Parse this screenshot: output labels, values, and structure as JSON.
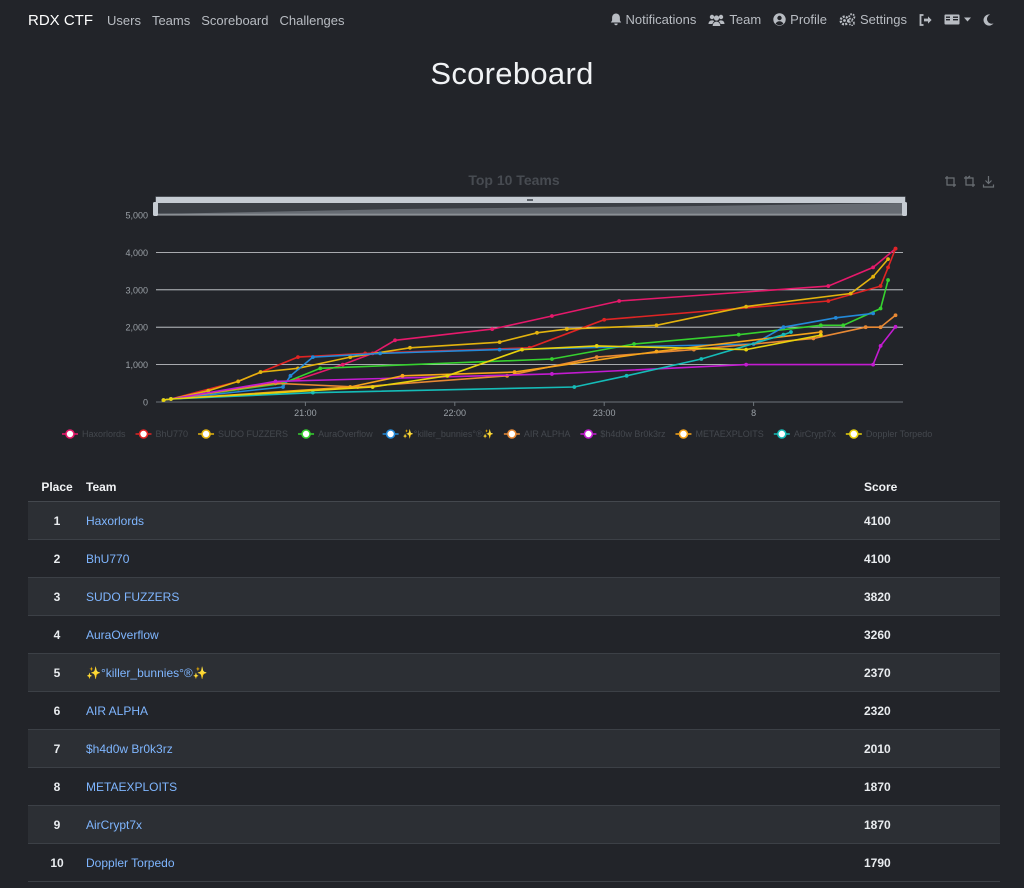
{
  "navbar": {
    "brand": "RDX CTF",
    "links": [
      "Users",
      "Teams",
      "Scoreboard",
      "Challenges"
    ],
    "right": {
      "notifications": "Notifications",
      "team": "Team",
      "profile": "Profile",
      "settings": "Settings"
    }
  },
  "page": {
    "title": "Scoreboard"
  },
  "chart_data": {
    "type": "line",
    "title": "Top 10 Teams",
    "xlabel": "",
    "ylabel": "",
    "x_ticks": [
      "21:00",
      "22:00",
      "23:00",
      "8"
    ],
    "y_ticks": [
      "0",
      "1,000",
      "2,000",
      "3,000",
      "4,000",
      "5,000"
    ],
    "ylim": [
      0,
      5000
    ],
    "xlim": [
      20.0,
      25.0
    ],
    "grid": true,
    "legend_position": "bottom",
    "series": [
      {
        "name": "Haxorlords",
        "color": "#e6196b",
        "points": [
          [
            20.05,
            50
          ],
          [
            20.1,
            80
          ],
          [
            20.55,
            350
          ],
          [
            20.95,
            600
          ],
          [
            21.25,
            1000
          ],
          [
            21.45,
            1300
          ],
          [
            21.6,
            1650
          ],
          [
            22.25,
            1950
          ],
          [
            22.65,
            2300
          ],
          [
            23.1,
            2700
          ],
          [
            24.5,
            3100
          ],
          [
            24.8,
            3600
          ],
          [
            24.95,
            4100
          ]
        ]
      },
      {
        "name": "BhU770",
        "color": "#e02424",
        "points": [
          [
            20.05,
            50
          ],
          [
            20.1,
            80
          ],
          [
            20.55,
            550
          ],
          [
            20.95,
            1200
          ],
          [
            21.4,
            1300
          ],
          [
            22.5,
            1450
          ],
          [
            23.0,
            2200
          ],
          [
            24.5,
            2700
          ],
          [
            24.85,
            3100
          ],
          [
            24.9,
            3600
          ],
          [
            24.95,
            4100
          ]
        ]
      },
      {
        "name": "SUDO FUZZERS",
        "color": "#e3b30e",
        "points": [
          [
            20.05,
            50
          ],
          [
            20.1,
            80
          ],
          [
            20.35,
            300
          ],
          [
            20.55,
            550
          ],
          [
            20.7,
            800
          ],
          [
            20.95,
            900
          ],
          [
            21.3,
            1200
          ],
          [
            21.7,
            1450
          ],
          [
            22.3,
            1600
          ],
          [
            22.55,
            1850
          ],
          [
            22.75,
            1950
          ],
          [
            23.35,
            2050
          ],
          [
            23.95,
            2550
          ],
          [
            24.65,
            2900
          ],
          [
            24.8,
            3350
          ],
          [
            24.9,
            3820
          ]
        ]
      },
      {
        "name": "AuraOverflow",
        "color": "#36d12f",
        "points": [
          [
            20.05,
            50
          ],
          [
            20.1,
            80
          ],
          [
            20.85,
            500
          ],
          [
            21.1,
            900
          ],
          [
            22.65,
            1150
          ],
          [
            23.2,
            1550
          ],
          [
            23.9,
            1800
          ],
          [
            24.45,
            2050
          ],
          [
            24.6,
            2050
          ],
          [
            24.85,
            2500
          ],
          [
            24.9,
            3260
          ]
        ]
      },
      {
        "name": "✨°killer_bunnies°®✨",
        "color": "#2389d8",
        "points": [
          [
            20.05,
            50
          ],
          [
            20.1,
            80
          ],
          [
            20.85,
            400
          ],
          [
            20.9,
            700
          ],
          [
            21.05,
            1200
          ],
          [
            21.5,
            1300
          ],
          [
            22.3,
            1400
          ],
          [
            24.0,
            1550
          ],
          [
            24.2,
            2000
          ],
          [
            24.55,
            2250
          ],
          [
            24.8,
            2370
          ]
        ]
      },
      {
        "name": "AIR ALPHA",
        "color": "#e88934",
        "points": [
          [
            20.05,
            50
          ],
          [
            20.1,
            80
          ],
          [
            20.8,
            500
          ],
          [
            21.35,
            400
          ],
          [
            22.35,
            700
          ],
          [
            22.95,
            1200
          ],
          [
            23.6,
            1400
          ],
          [
            24.4,
            1700
          ],
          [
            24.75,
            2000
          ],
          [
            24.85,
            2000
          ],
          [
            24.95,
            2320
          ]
        ]
      },
      {
        "name": "$h4d0w Br0k3rz",
        "color": "#c31bd1",
        "points": [
          [
            20.05,
            50
          ],
          [
            20.1,
            80
          ],
          [
            20.8,
            550
          ],
          [
            22.65,
            750
          ],
          [
            23.95,
            1000
          ],
          [
            24.8,
            1000
          ],
          [
            24.85,
            1500
          ],
          [
            24.95,
            2010
          ]
        ]
      },
      {
        "name": "METAEXPLOITS",
        "color": "#f5a31b",
        "points": [
          [
            20.05,
            50
          ],
          [
            20.1,
            80
          ],
          [
            21.3,
            400
          ],
          [
            21.65,
            700
          ],
          [
            22.4,
            800
          ],
          [
            23.35,
            1350
          ],
          [
            24.45,
            1870
          ]
        ]
      },
      {
        "name": "AirCrypt7x",
        "color": "#15bcb8",
        "points": [
          [
            20.05,
            50
          ],
          [
            20.1,
            80
          ],
          [
            21.05,
            250
          ],
          [
            22.8,
            400
          ],
          [
            23.15,
            700
          ],
          [
            23.65,
            1150
          ],
          [
            24.2,
            1800
          ],
          [
            24.25,
            1870
          ]
        ]
      },
      {
        "name": "Doppler Torpedo",
        "color": "#e8d20c",
        "points": [
          [
            20.05,
            50
          ],
          [
            20.1,
            80
          ],
          [
            21.45,
            400
          ],
          [
            21.95,
            700
          ],
          [
            22.45,
            1400
          ],
          [
            22.95,
            1500
          ],
          [
            23.95,
            1400
          ],
          [
            24.45,
            1790
          ]
        ]
      }
    ]
  },
  "table": {
    "headers": {
      "place": "Place",
      "team": "Team",
      "score": "Score"
    },
    "rows": [
      {
        "place": "1",
        "team": "Haxorlords",
        "score": "4100"
      },
      {
        "place": "2",
        "team": "BhU770",
        "score": "4100"
      },
      {
        "place": "3",
        "team": "SUDO FUZZERS",
        "score": "3820"
      },
      {
        "place": "4",
        "team": "AuraOverflow",
        "score": "3260"
      },
      {
        "place": "5",
        "team": "✨°killer_bunnies°®✨",
        "score": "2370"
      },
      {
        "place": "6",
        "team": "AIR ALPHA",
        "score": "2320"
      },
      {
        "place": "7",
        "team": "$h4d0w Br0k3rz",
        "score": "2010"
      },
      {
        "place": "8",
        "team": "METAEXPLOITS",
        "score": "1870"
      },
      {
        "place": "9",
        "team": "AirCrypt7x",
        "score": "1870"
      },
      {
        "place": "10",
        "team": "Doppler Torpedo",
        "score": "1790"
      }
    ]
  }
}
